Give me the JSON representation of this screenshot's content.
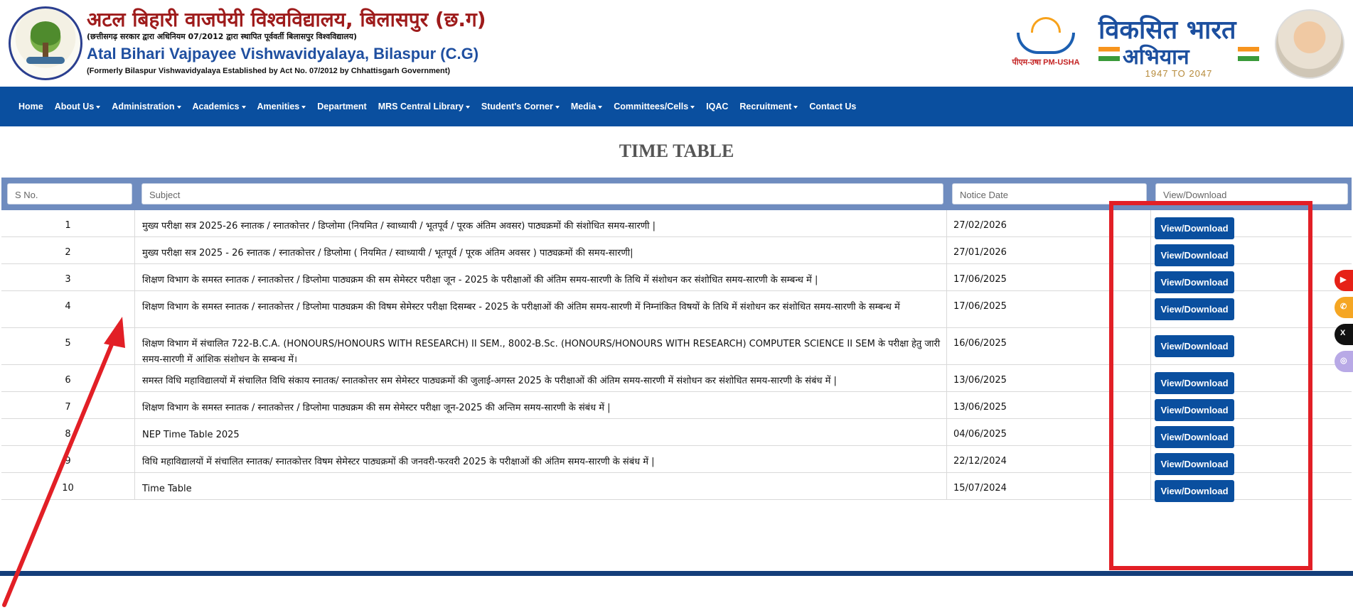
{
  "header": {
    "title_hi": "अटल बिहारी वाजपेयी विश्वविद्यालय, बिलासपुर (छ.ग)",
    "subtitle_hi": "(छत्तीसगढ़ सरकार द्वारा अधिनियम 07/2012 द्वारा स्थापित पूर्ववर्ती बिलासपुर विश्वविद्यालय)",
    "title_en": "Atal Bihari Vajpayee Vishwavidyalaya, Bilaspur (C.G)",
    "subtitle_en": "(Formerly Bilaspur Vishwavidyalaya Established by Act No. 07/2012 by Chhattisgarh Government)",
    "pm_usha_label": "पीएम-उषा PM-USHA",
    "viksit_line1": "विकसित भारत",
    "viksit_line2": "अभियान",
    "viksit_years": "1947 TO 2047"
  },
  "nav": {
    "items": [
      {
        "label": "Home",
        "dropdown": false
      },
      {
        "label": "About Us",
        "dropdown": true
      },
      {
        "label": "Administration",
        "dropdown": true
      },
      {
        "label": "Academics",
        "dropdown": true
      },
      {
        "label": "Amenities",
        "dropdown": true
      },
      {
        "label": "Department",
        "dropdown": false
      },
      {
        "label": "MRS Central Library",
        "dropdown": true
      },
      {
        "label": "Student's Corner",
        "dropdown": true
      },
      {
        "label": "Media",
        "dropdown": true
      },
      {
        "label": "Committees/Cells",
        "dropdown": true
      },
      {
        "label": "IQAC",
        "dropdown": false
      },
      {
        "label": "Recruitment",
        "dropdown": true
      },
      {
        "label": "Contact Us",
        "dropdown": false
      }
    ]
  },
  "page": {
    "title": "TIME TABLE"
  },
  "table": {
    "headers": {
      "sno": "S No.",
      "subject": "Subject",
      "notice_date": "Notice Date",
      "action": "View/Download"
    },
    "button_label": "View/Download",
    "rows": [
      {
        "sno": "1",
        "subject": "मुख्य परीक्षा सत्र 2025-26 स्नातक / स्नातकोत्तर / डिप्लोमा (नियमित / स्वाध्यायी / भूतपूर्व / पूरक अंतिम अवसर) पाठ्यक्रमों की संशोधित समय-सारणी |",
        "date": "27/02/2026"
      },
      {
        "sno": "2",
        "subject": "मुख्य परीक्षा सत्र 2025 - 26 स्नातक / स्नातकोत्तर / डिप्लोमा ( नियमित / स्वाध्यायी / भूतपूर्व / पूरक अंतिम अवसर ) पाठ्यक्रमों की समय-सारणी|",
        "date": "27/01/2026"
      },
      {
        "sno": "3",
        "subject": "शिक्षण विभाग के समस्त स्नातक / स्नातकोत्तर / डिप्लोमा पाठ्यक्रम की सम सेमेस्टर परीक्षा जून - 2025 के परीक्षाओं की अंतिम समय-सारणी के तिथि में संशोधन कर संशोधित समय-सारणी के सम्बन्ध में |",
        "date": "17/06/2025"
      },
      {
        "sno": "4",
        "subject": "शिक्षण विभाग के समस्त स्नातक / स्नातकोत्तर / डिप्लोमा पाठ्यक्रम की विषम सेमेस्टर परीक्षा दिसम्बर - 2025 के परीक्षाओं की अंतिम समय-सारणी में निम्नांकित विषयों के तिथि में संशोधन कर संशोधित समय-सारणी के सम्बन्ध में",
        "date": "17/06/2025"
      },
      {
        "sno": "5",
        "subject": "शिक्षण विभाग में संचालित 722-B.C.A. (HONOURS/HONOURS WITH RESEARCH) II SEM., 8002-B.Sc. (HONOURS/HONOURS WITH RESEARCH) COMPUTER SCIENCE II SEM के परीक्षा हेतु जारी समय-सारणी में आंशिक संशोधन के सम्बन्ध में।",
        "date": "16/06/2025"
      },
      {
        "sno": "6",
        "subject": "समस्त विधि महाविद्यालयों में संचालित विधि संकाय स्नातक/ स्नातकोत्तर सम सेमेस्टर पाठ्यक्रमों की जुलाई-अगस्त 2025 के परीक्षाओं की अंतिम समय-सारणी में संशोधन कर संशोधित समय-सारणी के संबंध में |",
        "date": "13/06/2025"
      },
      {
        "sno": "7",
        "subject": "शिक्षण विभाग के समस्त स्नातक / स्नातकोत्तर / डिप्लोमा पाठ्यक्रम की सम सेमेस्टर परीक्षा जून-2025 की अन्तिम समय-सारणी के संबंध में |",
        "date": "13/06/2025"
      },
      {
        "sno": "8",
        "subject": "NEP Time Table 2025",
        "date": "04/06/2025"
      },
      {
        "sno": "9",
        "subject": "विधि महाविद्यालयों में संचालित स्नातक/ स्नातकोत्तर विषम सेमेस्टर पाठ्यक्रमों की जनवरी-फरवरी 2025 के परीक्षाओं की अंतिम समय-सारणी के संबंध में |",
        "date": "22/12/2024"
      },
      {
        "sno": "10",
        "subject": "Time Table",
        "date": "15/07/2024"
      }
    ]
  },
  "social": [
    {
      "name": "youtube-icon",
      "glyph": "▶",
      "color": "#e62117"
    },
    {
      "name": "whatsapp-icon",
      "glyph": "✆",
      "color": "#f5a623"
    },
    {
      "name": "x-twitter-icon",
      "glyph": "X",
      "color": "#111111"
    },
    {
      "name": "instagram-icon",
      "glyph": "◎",
      "color": "#b8a9e6"
    }
  ],
  "colors": {
    "nav_bg": "#0a4f9f",
    "header_title": "#9e1b1b",
    "button_bg": "#0a4f9f",
    "table_header_bg": "#6f8cbf",
    "annotation_red": "#e21f26"
  }
}
